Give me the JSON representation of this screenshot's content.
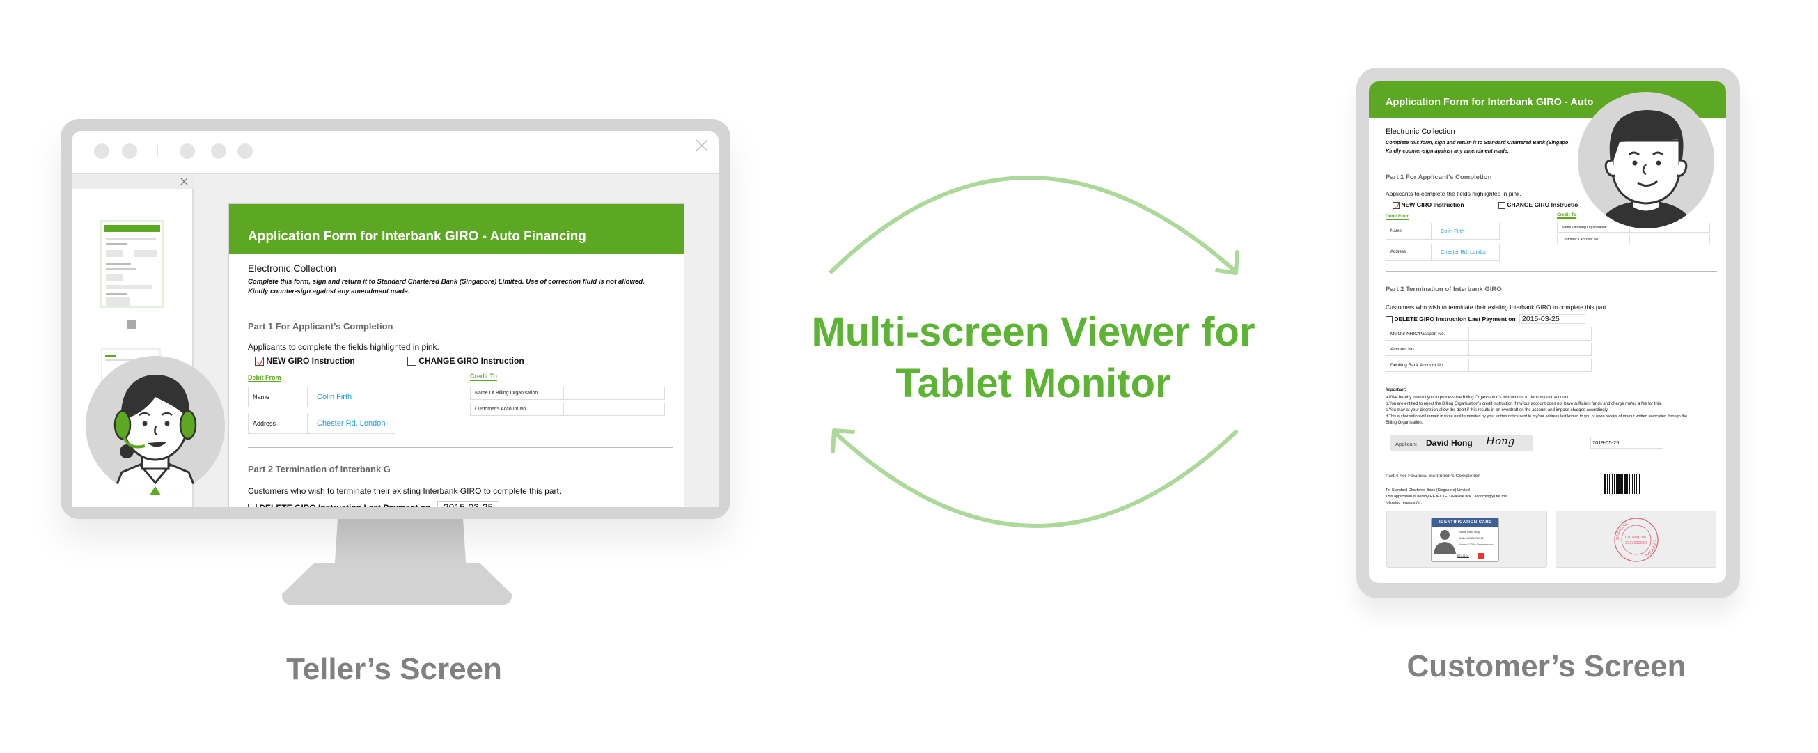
{
  "headline": {
    "line1": "Multi-screen Viewer for",
    "line2": "Tablet Monitor"
  },
  "labels": {
    "teller": "Teller’s Screen",
    "customer": "Customer’s Screen"
  },
  "colors": {
    "brand_green": "#5da823",
    "headline_green": "#5db334",
    "arrow_green": "#acd99a",
    "link_blue": "#1c9ee3",
    "label_gray": "#808080"
  },
  "form": {
    "title": "Application Form for Interbank GIRO - Auto Financing",
    "title_tablet": "Application Form for Interbank GIRO - Auto",
    "section": "Electronic Collection",
    "instructions1": "Complete this form, sign and return it to Standard Chartered Bank (Singapore) Limited. Use of correction fluid is not allowed.",
    "instructions1_tablet": "Complete this form, sign and return it to Standard Chartered Bank (Singapo",
    "instructions2": "Kindly counter-sign against any amendment made.",
    "part1": "Part 1 For Applicant’s Completion",
    "applicants_note": "Applicants to complete the fields highlighted in pink.",
    "new_giro": {
      "label": "NEW GIRO Instruction",
      "checked": true
    },
    "change_giro": {
      "label": "CHANGE GIRO Instruction",
      "checked": false
    },
    "change_giro_tablet": "CHANGE GIRO Instructio",
    "debit_from": "Debit From",
    "credit_to": "Credit To",
    "name_label": "Name",
    "name_value": "Colin Firth",
    "address_label": "Address",
    "address_value": "Chester Rd, London",
    "billing_org": "Name Of Billing Organisation",
    "customer_account": "Customer’s Account No.",
    "part2": "Part 2 Termination of Interbank GIRO",
    "part2_truncated": "Part 2 Termination of Interbank G",
    "customers_note": "Customers who wish to terminate their existing Interbank GIRO to complete this part.",
    "delete_giro": {
      "label": "DELETE GIRO Instruction Last Payment on",
      "date": "2015-03-25",
      "checked": false
    },
    "nric": "My/Our NRIC/Passport No.",
    "account_no": "Account No.",
    "debiting_account": "Debiting Bank Account No.",
    "important_title": "Important:",
    "important": [
      "a.I/We hereby instruct you to process the Billing Organisation’s instructions to debit my/our account.",
      "b.You are entitled to reject the Billing Organisation’s credit instruction if my/our account does not have sufficient funds and charge me/us a fee for this.",
      "c.You may at your discretion allow the debit if this results in an overdraft on the account and impose charges accordingly.",
      "d.This authorisation will remain in force until terminated by your written notice sent to my/our address last known to you or upon receipt of my/our written revocation through the",
      "Billing Organisation."
    ],
    "applicant_label": "Applicant",
    "applicant_name": "David Hong",
    "signature": "Hong",
    "sign_date": "2019-05-25",
    "part4": "Part 4 For Financial Institution’s Completion",
    "part4_lines": [
      "To: Standard Chartered Bank (Singapore) Limited",
      "This application is hereby REJECTED (Please tick “  accordingly) for the",
      "following reasons (s):"
    ],
    "id_card": {
      "title": "IDENTIFICATION CARD",
      "name_label": "Name:",
      "name": "David Hong",
      "no_label": "D-No:",
      "no": "123456-789112",
      "addr_label": "Adress:",
      "addr": "123 M, Cheonjansan-ro",
      "date": "2017.01.01"
    },
    "stamp": {
      "ring": "OFFICIAL",
      "line1": "Co. Reg. No.",
      "line2": "201700003D"
    }
  },
  "barcode": [
    3,
    1,
    2,
    1,
    1,
    3,
    1,
    2,
    2,
    1,
    1,
    1,
    3,
    1,
    2,
    1,
    1,
    2,
    3,
    1,
    1,
    2,
    1,
    3,
    2,
    1,
    1,
    1,
    2,
    3,
    1,
    2
  ]
}
